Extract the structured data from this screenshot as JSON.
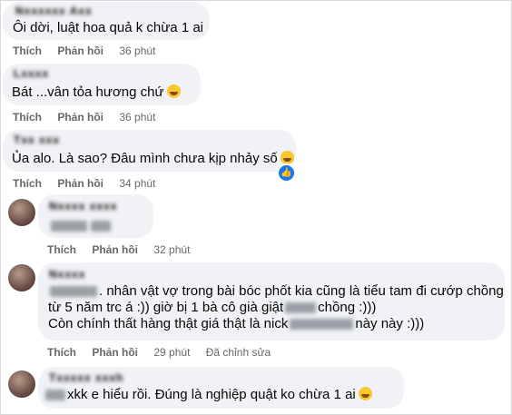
{
  "comments": [
    {
      "text": "Ôi dời, luật hoa quả k chừa 1 ai",
      "like": "Thích",
      "reply": "Phản hồi",
      "time": "36 phút"
    },
    {
      "text": "Bát ...vân tỏa hương chứ",
      "like": "Thích",
      "reply": "Phản hồi",
      "time": "36 phút"
    },
    {
      "text": "Ủa alo. Là sao? Đâu mình chưa kịp nhảy số",
      "like": "Thích",
      "reply": "Phản hồi",
      "time": "34 phút"
    },
    {
      "like": "Thích",
      "reply": "Phản hồi",
      "time": "32 phút"
    },
    {
      "line1": "nhân vật vợ trong bài bóc phốt kia cũng là tiểu tam đi cướp chồng",
      "line2": "từ 5 năm trc á :)) giờ bị 1 bà cô già giật",
      "line2b": "chồng :)))",
      "line3": "Còn chính thất hàng thật giá thật là nick",
      "line3b": "này này :)))",
      "like": "Thích",
      "reply": "Phản hồi",
      "time": "29 phút",
      "edited": "Đã chỉnh sửa"
    },
    {
      "text": "xkk e hiểu rồi. Đúng là nghiệp quật ko chừa 1 ai"
    }
  ],
  "icons": {
    "reaction": "haha-emoji-icon",
    "like_badge": "like-badge-icon"
  }
}
